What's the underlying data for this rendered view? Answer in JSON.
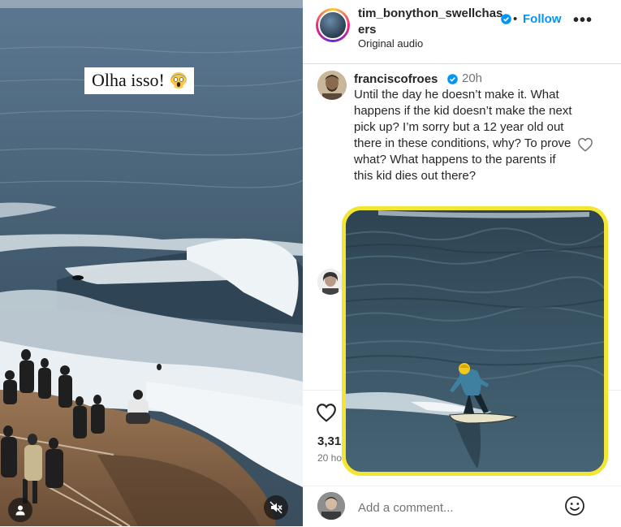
{
  "video": {
    "caption": "Olha isso!",
    "caption_emoji": "screaming-face-emoji",
    "user_tag_icon": "user-icon",
    "mute_icon": "muted-speaker-icon"
  },
  "post": {
    "username": "tim_bonython_swellchasers",
    "follow_separator": "•",
    "follow_label": "Follow",
    "more_label": "•••",
    "audio_label": "Original audio"
  },
  "comment": {
    "username": "franciscofroes",
    "time": "20h",
    "text": "Until the day he doesn’t make it. What happens if the kid doesn’t make the next pick up? I’m sorry but a 12 year old out there in these conditions, why? To prove what? What happens to the parents if this kid dies out there?"
  },
  "footer": {
    "likes": "3,31",
    "date": "20 ho",
    "comment_placeholder": "Add a comment..."
  },
  "colors": {
    "accent_blue": "#0095f6",
    "verified_blue": "#0095f6",
    "highlight_border": "#f3e533",
    "muted_text": "#737373"
  }
}
